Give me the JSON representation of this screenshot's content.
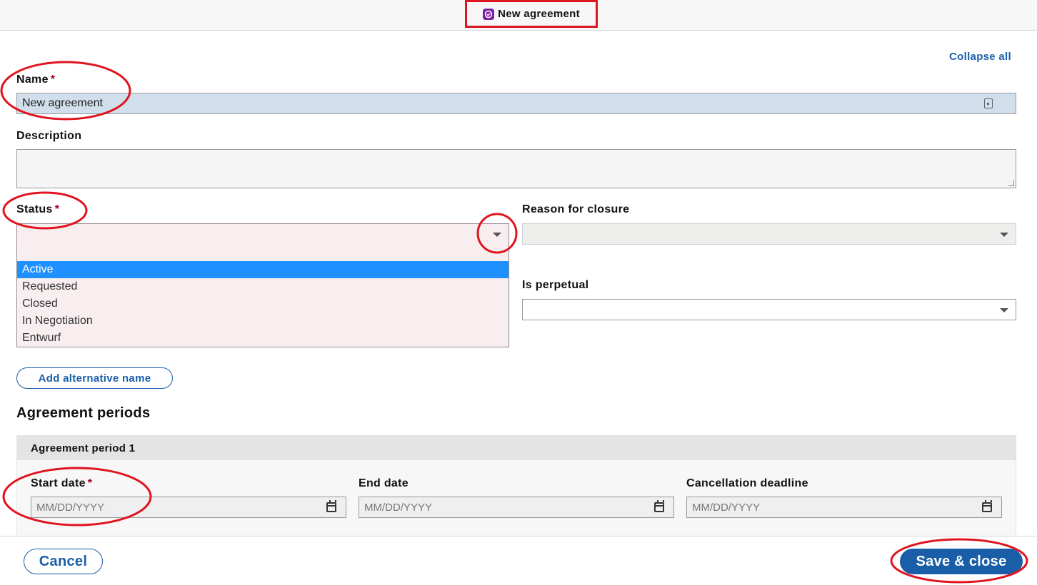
{
  "header": {
    "title": "New agreement",
    "icon": "agreement-app-icon"
  },
  "toolbar": {
    "collapse_all": "Collapse all"
  },
  "form": {
    "name": {
      "label": "Name",
      "required_mark": "*",
      "value": "New agreement"
    },
    "description": {
      "label": "Description",
      "value": ""
    },
    "status": {
      "label": "Status",
      "required_mark": "*",
      "value": "",
      "options": [
        "",
        "Active",
        "Requested",
        "Closed",
        "In Negotiation",
        "Entwurf"
      ],
      "highlighted": "Active"
    },
    "reason_for_closure": {
      "label": "Reason for closure",
      "value": ""
    },
    "is_perpetual": {
      "label": "Is perpetual",
      "value": ""
    },
    "add_alt_name": "Add alternative name"
  },
  "periods": {
    "title": "Agreement periods",
    "items": [
      {
        "header": "Agreement period 1",
        "start_date": {
          "label": "Start date",
          "required_mark": "*",
          "placeholder": "MM/DD/YYYY"
        },
        "end_date": {
          "label": "End date",
          "placeholder": "MM/DD/YYYY"
        },
        "cancellation_deadline": {
          "label": "Cancellation deadline",
          "placeholder": "MM/DD/YYYY"
        }
      }
    ]
  },
  "footer": {
    "cancel": "Cancel",
    "save_close": "Save & close"
  },
  "colors": {
    "accent": "#1a5ea8",
    "annotation": "#e0141e",
    "selected_option": "#1e90ff",
    "required": "#b00020"
  }
}
